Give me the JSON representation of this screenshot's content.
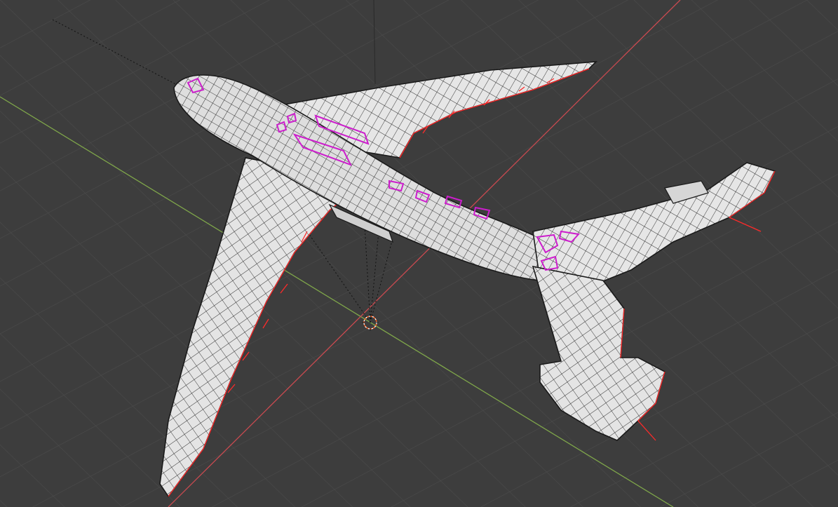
{
  "viewport": {
    "mode": "3d-viewport-wireframe-overlay",
    "background_color": "#3d3d3d",
    "grid_color": "#4a4a4a",
    "x_axis_color": "#d44a4f",
    "y_axis_color": "#7fa64a",
    "object": {
      "name_visible": false,
      "kind": "airplane-mesh",
      "surface_color": "#e3e3e3",
      "edge_color": "#1f1f1f",
      "selected_edge_color": "#cc1ecc",
      "outline_color": "#ff2a2a"
    },
    "gizmos": {
      "light_icon": "light-source-icon",
      "origin_icon": "origin-crosshair-icon"
    }
  }
}
